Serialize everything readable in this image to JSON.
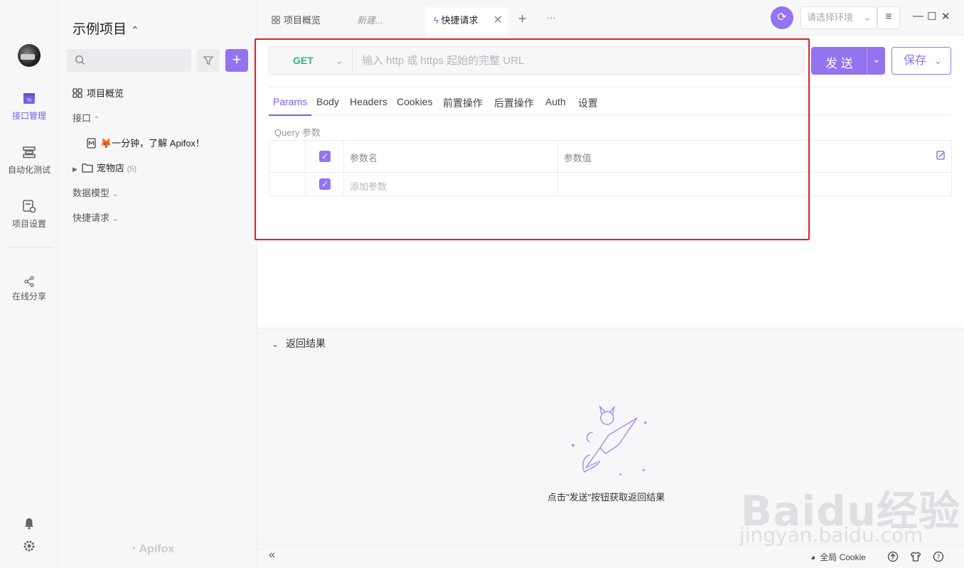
{
  "rail": {
    "items": [
      {
        "label": "接口管理",
        "icon": "api-icon",
        "active": true
      },
      {
        "label": "自动化测试",
        "icon": "automation-icon",
        "active": false
      },
      {
        "label": "项目设置",
        "icon": "project-settings-icon",
        "active": false
      },
      {
        "label": "在线分享",
        "icon": "share-icon",
        "active": false
      }
    ]
  },
  "sidebar": {
    "project_title": "示例项目",
    "project_chevron": "⌃⌄",
    "search_placeholder": "",
    "overview_label": "项目概览",
    "api_group_label": "接口",
    "api_item_label": "🦊一分钟，了解 Apifox！",
    "folder_label": "宠物店",
    "folder_count": "(5)",
    "schema_group_label": "数据模型",
    "quick_group_label": "快捷请求",
    "brand": "Apifox"
  },
  "tabs": [
    {
      "label": "项目概览",
      "style": "normal"
    },
    {
      "label": "新建...",
      "style": "italic"
    },
    {
      "label": "快捷请求",
      "style": "active"
    }
  ],
  "header": {
    "env_placeholder": "请选择环境",
    "add_tab": "+",
    "more_tabs": "···",
    "minimize": "—",
    "maximize": "☐",
    "close": "✕"
  },
  "request": {
    "method": "GET",
    "url_value": "",
    "url_placeholder": "输入 http 或 https 起始的完整 URL",
    "send_label": "发 送",
    "save_label": "保存",
    "sub_tabs": [
      "Params",
      "Body",
      "Headers",
      "Cookies",
      "前置操作",
      "后置操作",
      "Auth",
      "设置"
    ],
    "active_sub_tab": "Params",
    "query_label": "Query 参数",
    "param_name_header": "参数名",
    "param_value_header": "参数值",
    "add_param_placeholder": "添加参数"
  },
  "response": {
    "title": "返回结果",
    "hint": "点击\"发送\"按钮获取返回结果"
  },
  "footer": {
    "collapse": "«",
    "cookie_label": "全局 Cookie"
  },
  "watermark": {
    "main": "Baidu经验",
    "sub": "jingyan.baidu.com"
  },
  "colors": {
    "accent": "#9373ee",
    "get_method": "#2fb87a",
    "annotation": "#e02020"
  }
}
